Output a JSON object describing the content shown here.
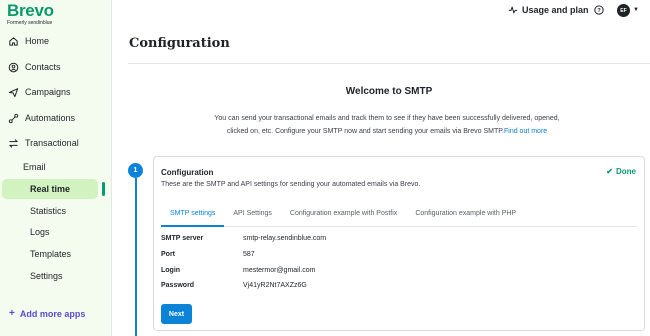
{
  "brand": {
    "name": "Brevo",
    "subtitle": "Formerly sendinblue"
  },
  "nav": [
    {
      "label": "Home",
      "icon": "home-icon"
    },
    {
      "label": "Contacts",
      "icon": "contacts-icon"
    },
    {
      "label": "Campaigns",
      "icon": "send-icon"
    },
    {
      "label": "Automations",
      "icon": "automation-icon"
    },
    {
      "label": "Transactional",
      "icon": "transactional-icon"
    }
  ],
  "subnav": {
    "section": "Email",
    "items": [
      "Real time",
      "Statistics",
      "Logs",
      "Templates",
      "Settings"
    ],
    "active": "Real time"
  },
  "add_apps": "Add more apps",
  "topbar": {
    "usage_label": "Usage and plan",
    "avatar_initials": "EF"
  },
  "page": {
    "title": "Configuration"
  },
  "welcome": {
    "heading": "Welcome to SMTP",
    "line1": "You can send your transactional emails and track them to see if they have been successfully delivered, opened,",
    "line2": "clicked on, etc. Configure your SMTP now and start sending your emails via Brevo SMTP.",
    "link": "Find out more"
  },
  "step": {
    "number": "1",
    "title": "Configuration",
    "description": "These are the SMTP and API settings for sending your automated emails via Brevo.",
    "status": "Done",
    "tabs": [
      "SMTP settings",
      "API Settings",
      "Configuration example with Postfix",
      "Configuration example with PHP"
    ],
    "active_tab": "SMTP settings",
    "fields": [
      {
        "key": "SMTP server",
        "value": "smtp-relay.sendinblue.com"
      },
      {
        "key": "Port",
        "value": "587"
      },
      {
        "key": "Login",
        "value": "mestermor@gmail.com"
      },
      {
        "key": "Password",
        "value": "Vj41yR2Nt7AXZz6G"
      }
    ],
    "next_label": "Next"
  },
  "colors": {
    "brand_green": "#0b996e",
    "accent_blue": "#0b84d8",
    "sidebar_bg": "#f4fbef",
    "active_bg": "#d2f2c0",
    "add_apps": "#5b4bcf"
  }
}
